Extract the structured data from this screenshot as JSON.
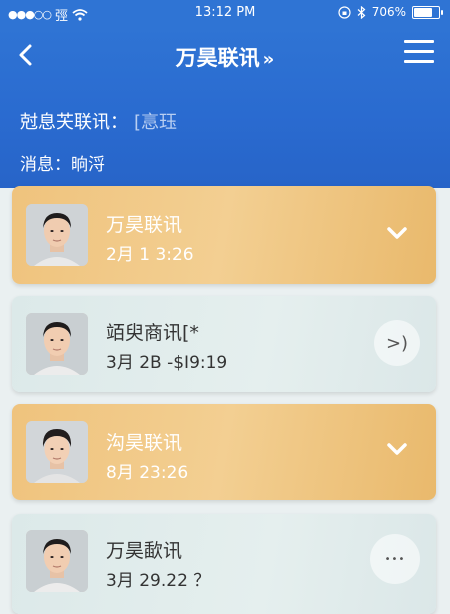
{
  "status": {
    "carrier": "弳",
    "time": "13:12 PM",
    "battery": "706%",
    "battery_level": 0.7
  },
  "header": {
    "title": "万昊联讯",
    "title_chevron": "»",
    "info1_label": "尅息芖联讯：",
    "info1_value": "[悥珏",
    "info2": "消息：晌浖"
  },
  "conversations": [
    {
      "name": "万昊联讯",
      "time": "2月 1 3:26",
      "style": "gold",
      "action_icon": "chevron-down-icon"
    },
    {
      "name": "竡臾商讯[*",
      "time": "3月 2B -$I9:19",
      "style": "light",
      "action_icon": "chevron-right-icon",
      "action_glyph": ">)"
    },
    {
      "name": "沟昊联讯",
      "time": "8月 23:26",
      "style": "gold",
      "action_icon": "chevron-down-icon"
    },
    {
      "name": "万昊歃讯",
      "time": "3月 29.22  ？",
      "style": "light",
      "action_icon": "more-icon",
      "action_glyph": "•••"
    }
  ],
  "colors": {
    "header_blue": "#2f74d4",
    "gold_card": "#f0c67f",
    "light_card": "#e1ecec"
  }
}
